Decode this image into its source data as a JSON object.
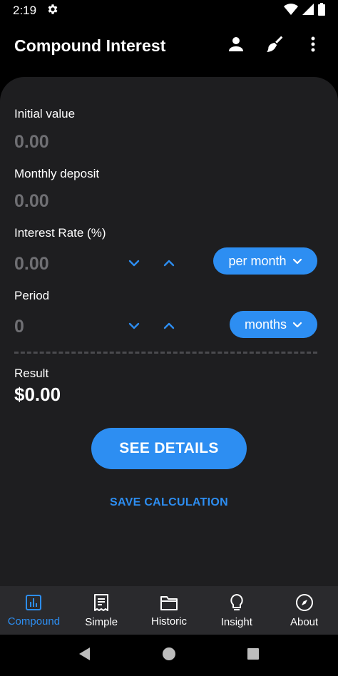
{
  "status_bar": {
    "time": "2:19"
  },
  "app_bar": {
    "title": "Compound Interest"
  },
  "form": {
    "initial_value": {
      "label": "Initial value",
      "value": "0.00"
    },
    "monthly_deposit": {
      "label": "Monthly deposit",
      "value": "0.00"
    },
    "interest_rate": {
      "label": "Interest Rate (%)",
      "value": "0.00",
      "unit": "per month"
    },
    "period": {
      "label": "Period",
      "value": "0",
      "unit": "months"
    }
  },
  "result": {
    "label": "Result",
    "value": "$0.00"
  },
  "actions": {
    "see_details": "SEE DETAILS",
    "save_calculation": "SAVE CALCULATION"
  },
  "bottom_nav": {
    "items": [
      {
        "label": "Compound",
        "icon": "bar-chart-icon",
        "active": true
      },
      {
        "label": "Simple",
        "icon": "receipt-icon",
        "active": false
      },
      {
        "label": "Historic",
        "icon": "folder-icon",
        "active": false
      },
      {
        "label": "Insight",
        "icon": "lightbulb-icon",
        "active": false
      },
      {
        "label": "About",
        "icon": "compass-icon",
        "active": false
      }
    ]
  },
  "colors": {
    "accent": "#2d8ef2",
    "card": "#1e1e20",
    "nav": "#2a2a2d",
    "placeholder": "#6f6f73"
  }
}
